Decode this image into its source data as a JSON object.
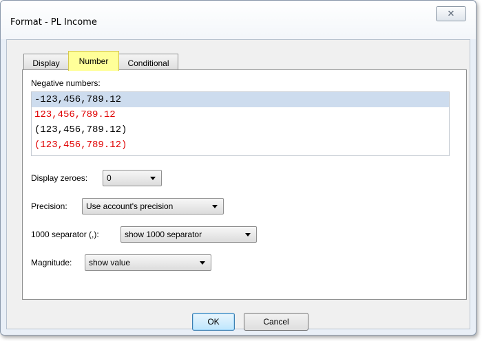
{
  "window": {
    "title": "Format -  PL Income",
    "close_glyph": "✕"
  },
  "tabs": [
    {
      "label": "Display",
      "active": false
    },
    {
      "label": "Number",
      "active": true
    },
    {
      "label": "Conditional",
      "active": false
    }
  ],
  "negative_numbers": {
    "label": "Negative numbers:",
    "options": [
      {
        "text": "-123,456,789.12",
        "color": "#000000",
        "selected": true
      },
      {
        "text": "123,456,789.12",
        "color": "#e00000",
        "selected": false
      },
      {
        "text": "(123,456,789.12)",
        "color": "#000000",
        "selected": false
      },
      {
        "text": "(123,456,789.12)",
        "color": "#e00000",
        "selected": false
      }
    ]
  },
  "display_zeroes": {
    "label": "Display zeroes:",
    "value": "0"
  },
  "precision": {
    "label": "Precision:",
    "value": "Use account's precision"
  },
  "separator": {
    "label": "1000 separator (,):",
    "value": "show 1000 separator"
  },
  "magnitude": {
    "label": "Magnitude:",
    "value": "show value"
  },
  "buttons": {
    "ok": "OK",
    "cancel": "Cancel"
  },
  "colors": {
    "active_tab": "#ffff99",
    "negative_red": "#e00000",
    "selection": "#cddcee"
  }
}
